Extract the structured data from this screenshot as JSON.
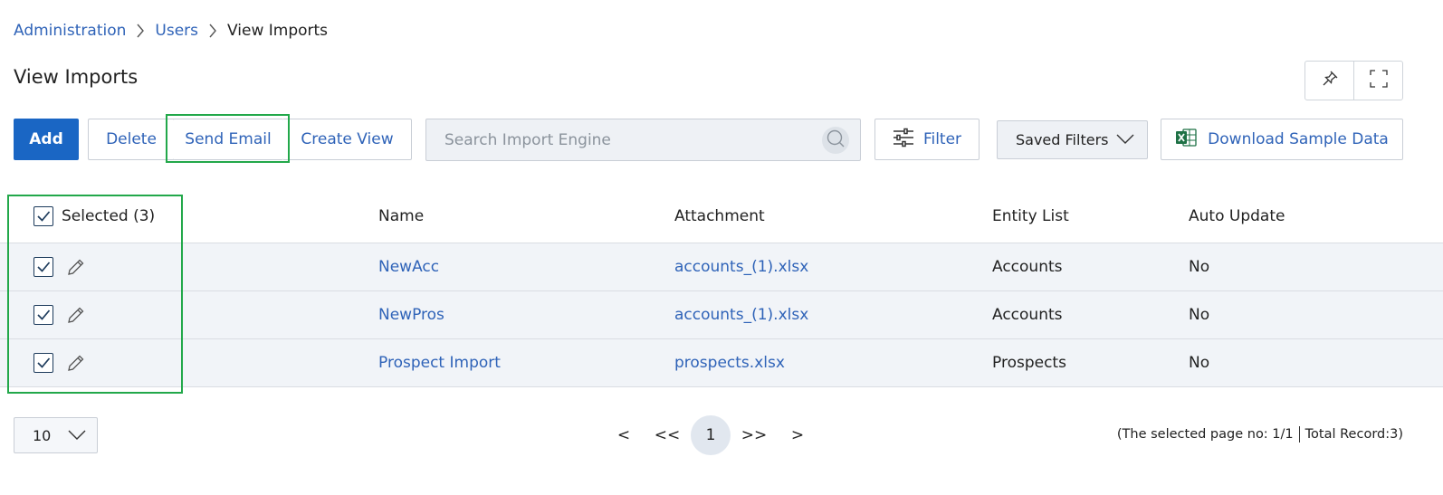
{
  "breadcrumb": {
    "items": [
      "Administration",
      "Users"
    ],
    "current": "View Imports"
  },
  "page_title": "View Imports",
  "toolbar": {
    "add": "Add",
    "delete": "Delete",
    "send_email": "Send Email",
    "create_view": "Create View",
    "search_placeholder": "Search Import Engine",
    "filter": "Filter",
    "saved_filters": "Saved Filters",
    "download": "Download Sample Data"
  },
  "table": {
    "selected_label": "Selected (3)",
    "columns": [
      "Name",
      "Attachment",
      "Entity List",
      "Auto Update"
    ],
    "rows": [
      {
        "name": "NewAcc",
        "attachment": "accounts_(1).xlsx",
        "entity": "Accounts",
        "auto_update": "No"
      },
      {
        "name": "NewPros",
        "attachment": "accounts_(1).xlsx",
        "entity": "Accounts",
        "auto_update": "No"
      },
      {
        "name": "Prospect Import",
        "attachment": "prospects.xlsx",
        "entity": "Prospects",
        "auto_update": "No"
      }
    ]
  },
  "pagination": {
    "page_size": "10",
    "prev": "<",
    "first": "<<",
    "current": "1",
    "last": ">>",
    "next": ">",
    "page_info": "(The selected page no: 1/1",
    "total_info": "Total Record:3)"
  },
  "icons": [
    "pin-icon",
    "expand-icon",
    "search-icon",
    "filter-icon",
    "chevron-down-icon",
    "excel-icon",
    "edit-icon",
    "checkbox-checked-icon"
  ],
  "colors": {
    "primary": "#1a66c4",
    "link": "#2f63b8",
    "highlight": "#22a84a",
    "row_bg": "#f1f4f8"
  }
}
